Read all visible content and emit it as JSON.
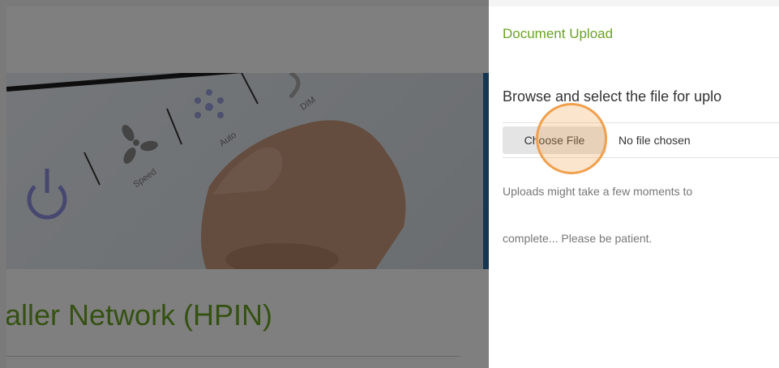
{
  "background_page": {
    "heading": "aller Network (HPIN)",
    "hero_labels": {
      "speed": "Speed",
      "auto": "Auto",
      "dim": "DIM"
    },
    "hero_icons": [
      "power-icon",
      "fan-icon",
      "snowflake-icon"
    ]
  },
  "upload_panel": {
    "title": "Document Upload",
    "prompt": "Browse and select the file for uplo",
    "choose_file_label": "Choose File",
    "no_file_text": "No file chosen",
    "help_line1": "Uploads might take a few moments to",
    "help_line2": "complete... Please be patient."
  },
  "colors": {
    "accent_green": "#6aa224",
    "hero_accent_blue": "#2d6ea6",
    "click_indicator": "#f0a04d"
  }
}
